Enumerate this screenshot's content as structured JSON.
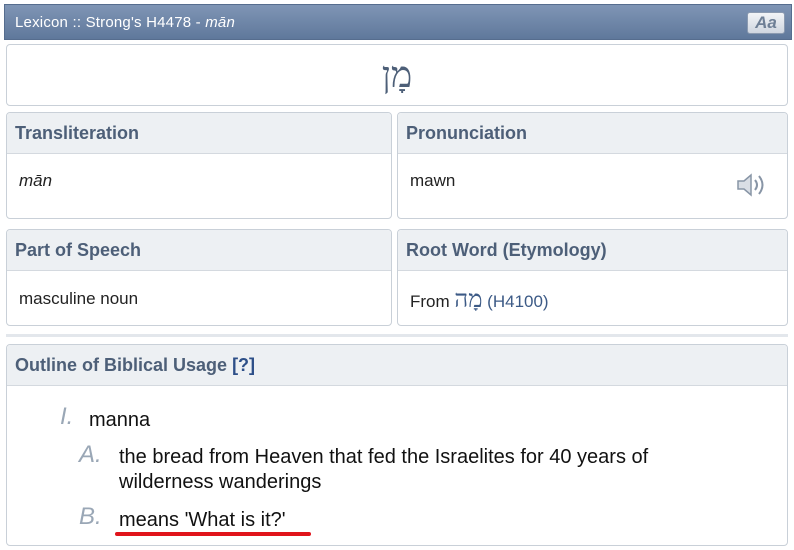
{
  "titlebar": {
    "prefix": "Lexicon :: Strong's H4478 - ",
    "word": "mān",
    "font_button": "Aa"
  },
  "hebrew_word": "מָן",
  "transliteration": {
    "label": "Transliteration",
    "value": "mān"
  },
  "pronunciation": {
    "label": "Pronunciation",
    "value": "mawn",
    "icon": "speaker-icon"
  },
  "part_of_speech": {
    "label": "Part of Speech",
    "value": "masculine noun"
  },
  "root_word": {
    "label": "Root Word (Etymology)",
    "from": "From",
    "hebrew": "מָה",
    "ref": "(H4100)"
  },
  "outline": {
    "label": "Outline of Biblical Usage",
    "help": "[?]",
    "items": [
      {
        "marker": "I.",
        "text": "manna"
      },
      {
        "marker": "A.",
        "text_line1": "the bread from Heaven that fed the Israelites for 40 years of",
        "text_line2": "wilderness wanderings"
      },
      {
        "marker": "B.",
        "text": "means 'What is it?'"
      }
    ]
  },
  "colors": {
    "titlebar": "#6b83a7",
    "header_text": "#4d5f78",
    "link": "#3c5a86",
    "underline": "#e0141b"
  }
}
